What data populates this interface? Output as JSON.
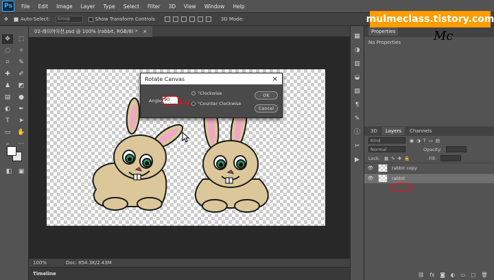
{
  "app": {
    "logo": "Ps"
  },
  "menu": [
    "File",
    "Edit",
    "Image",
    "Layer",
    "Type",
    "Select",
    "Filter",
    "3D",
    "View",
    "Window",
    "Help"
  ],
  "options": {
    "auto_select": "Auto-Select:",
    "group": "Group",
    "transform_controls": "Show Transform Controls",
    "mode_3d": "3D Mode:"
  },
  "document": {
    "tab_title": "02-레이어이전.psd @ 100% (rabbit, RGB/8) *",
    "zoom": "100%",
    "doc_info": "Doc: 854.3K/2.43M"
  },
  "timeline": {
    "label": "Timeline"
  },
  "dialog": {
    "title": "Rotate Canvas",
    "angle_label": "Angle:",
    "angle_value": "90",
    "clockwise": "°Clockwise",
    "counter_clockwise": "°Counter Clockwise",
    "ok": "OK",
    "cancel": "Cancel"
  },
  "properties": {
    "tab": "Properties",
    "status": "No Properties"
  },
  "layers_panel": {
    "tabs": [
      "3D",
      "Layers",
      "Channels"
    ],
    "kind": "Kind",
    "blend_mode": "Normal",
    "opacity_label": "Opacity:",
    "lock_label": "Lock:",
    "fill_label": "Fill:",
    "layers": [
      {
        "name": "rabbit copy",
        "selected": false
      },
      {
        "name": "rabbit",
        "selected": true
      }
    ]
  },
  "watermark": {
    "text": "mulmeclass.tistory.com",
    "signature": "Mc"
  },
  "colors": {
    "accent": "#ff9c00",
    "annotation": "#e0141e"
  }
}
